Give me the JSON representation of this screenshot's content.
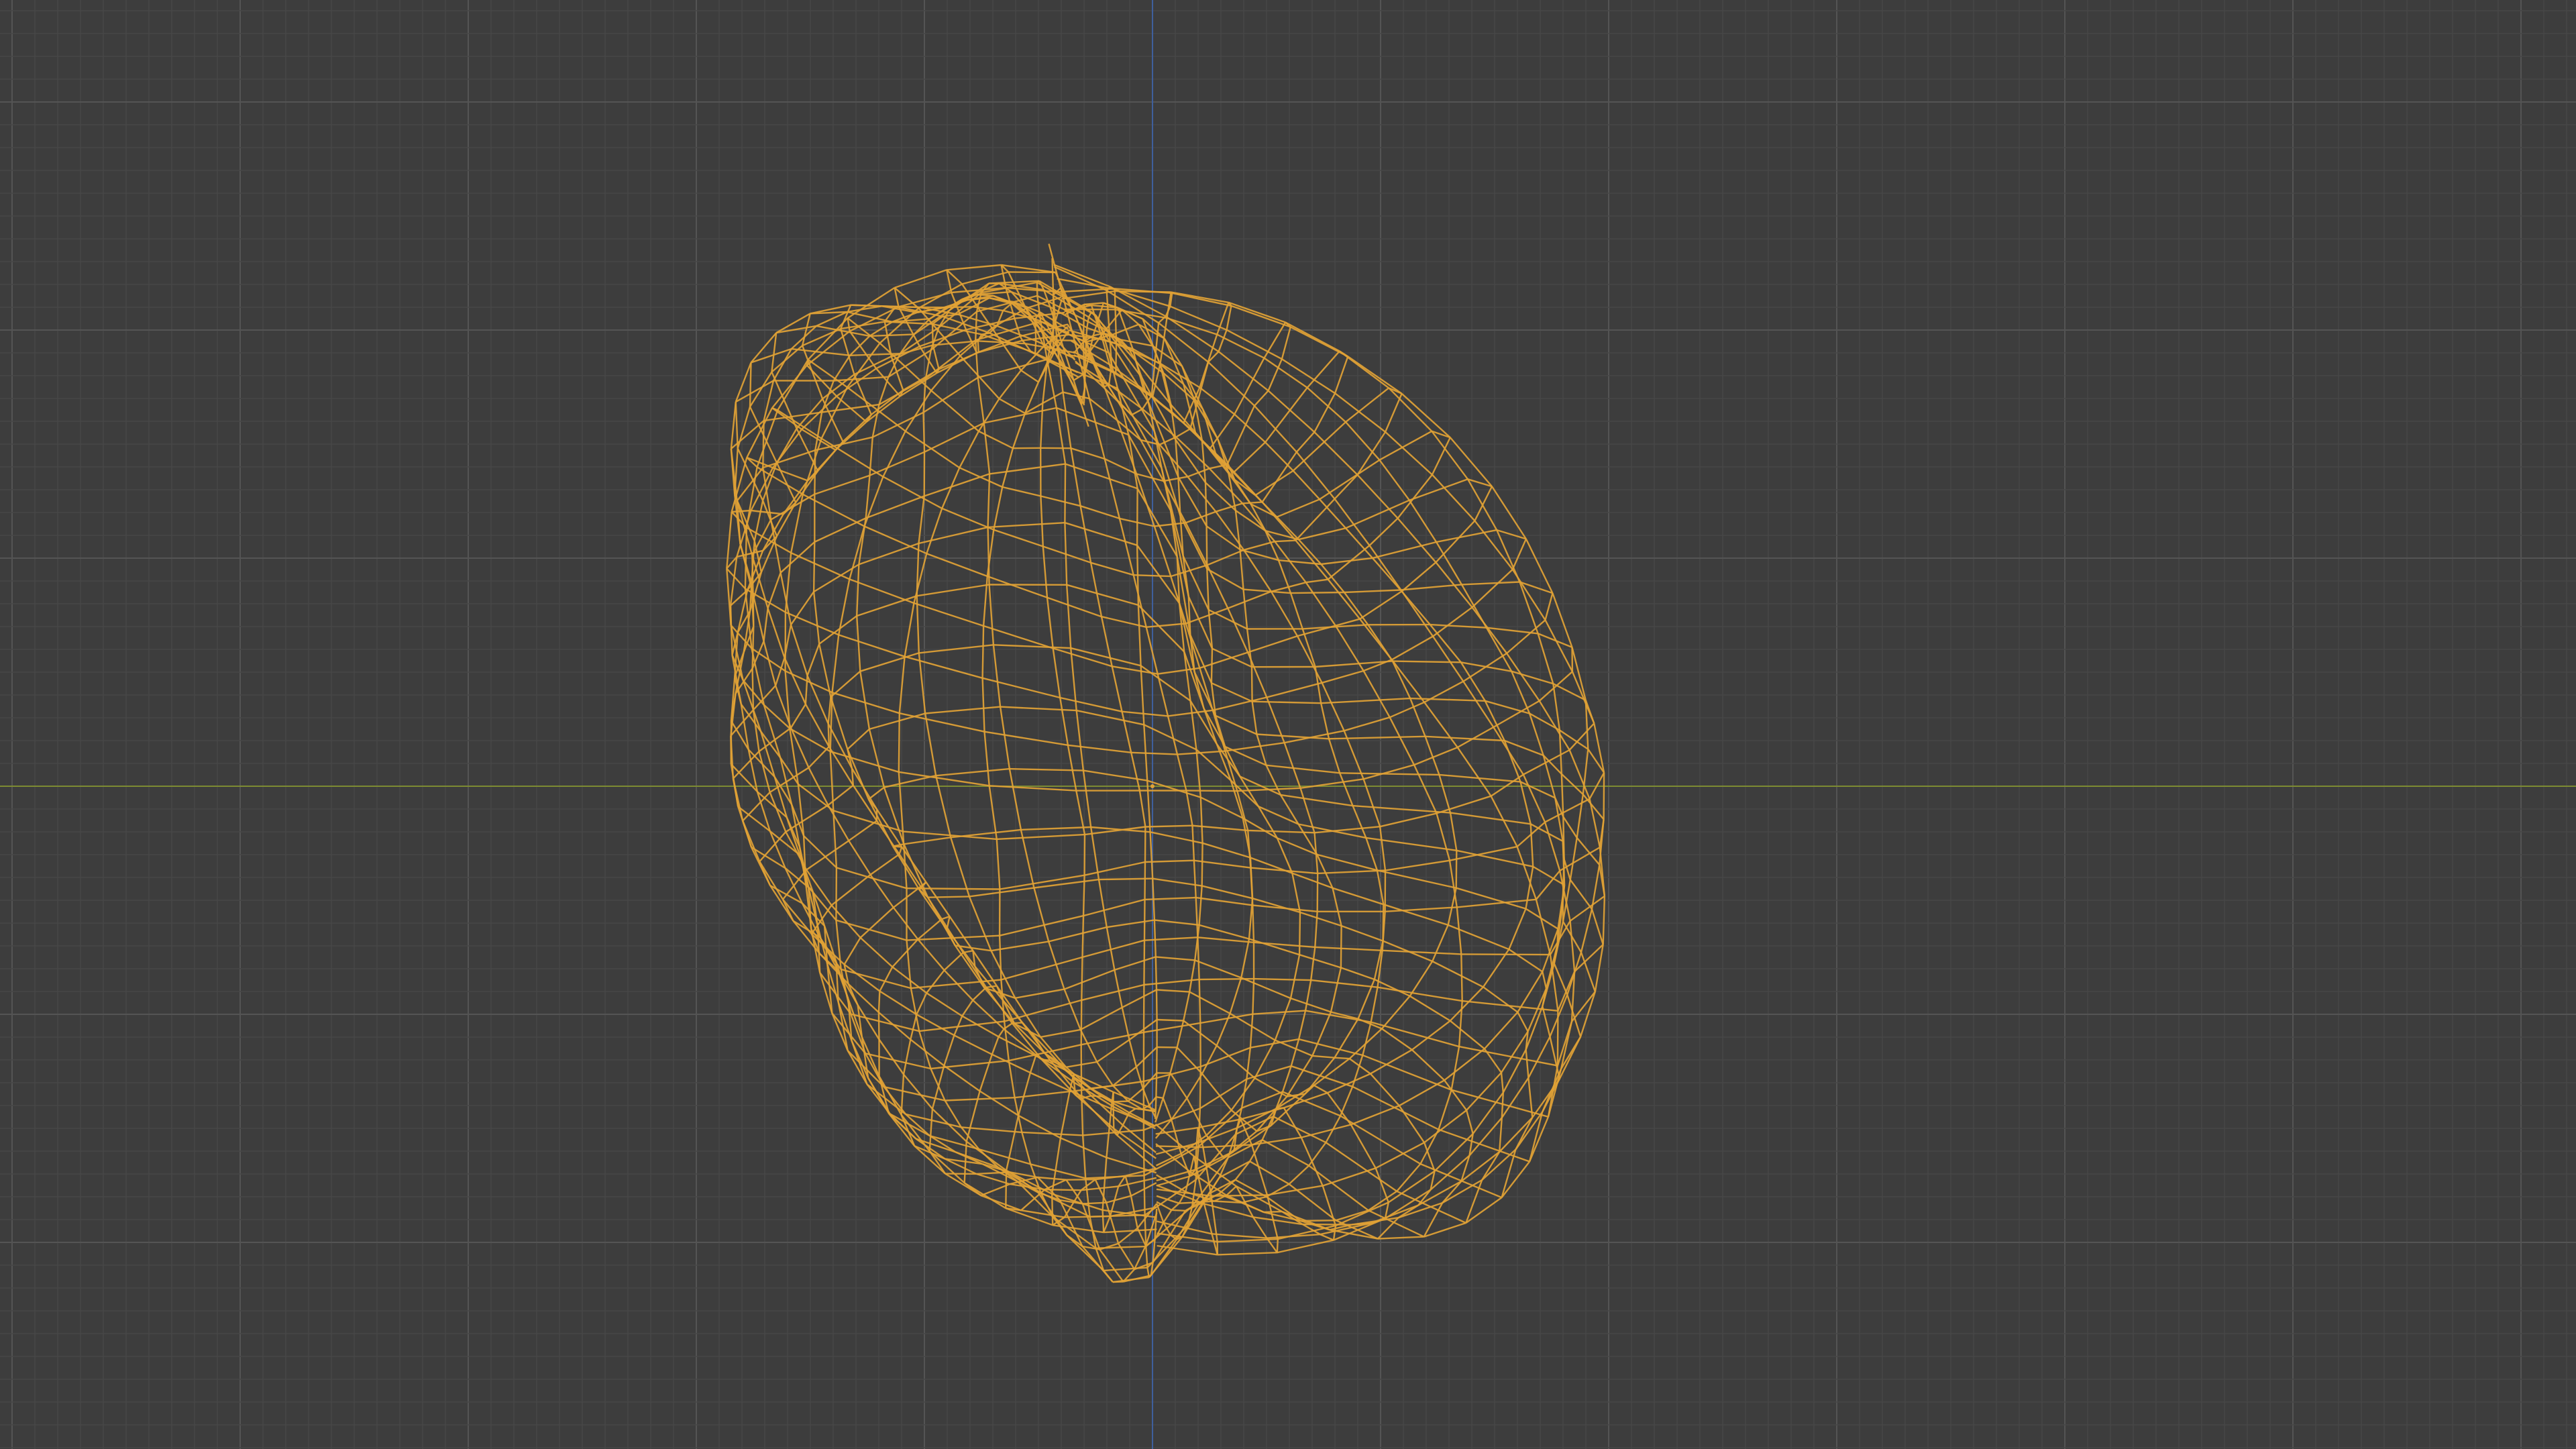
{
  "viewport": {
    "background_color": "#3d3d3d",
    "grid_minor_color": "#474747",
    "grid_major_color": "#545454",
    "x_axis_color": "#7d8b32",
    "z_axis_color": "#3f5f9c",
    "wire_color": "#e1a235",
    "object": {
      "name_icon": "mesh-rock-icon",
      "selected": true,
      "display_mode": "wireframe"
    }
  }
}
